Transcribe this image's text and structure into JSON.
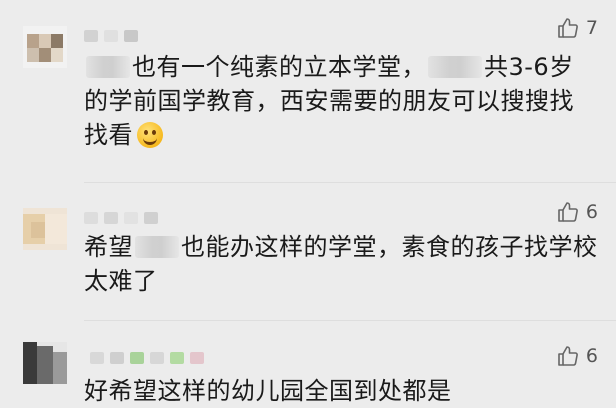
{
  "comments": [
    {
      "likes": "7",
      "text_a": "也有一个纯素的立本学堂，",
      "text_b": "共3-6岁的学前国学教育，西安需要的朋友可以搜搜找找看",
      "emoji": "smiley-emoji"
    },
    {
      "likes": "6",
      "text_a": "希望",
      "text_b": "也能办这样的学堂，素食的孩子找学校太难了"
    },
    {
      "likes": "6",
      "text_a": "好希望这样的幼儿园全国到处都是"
    }
  ],
  "icons": {
    "like": "thumbs-up-icon"
  },
  "colors": {
    "background": "#ececec",
    "text": "#1a1a1a",
    "meta": "#555555"
  }
}
